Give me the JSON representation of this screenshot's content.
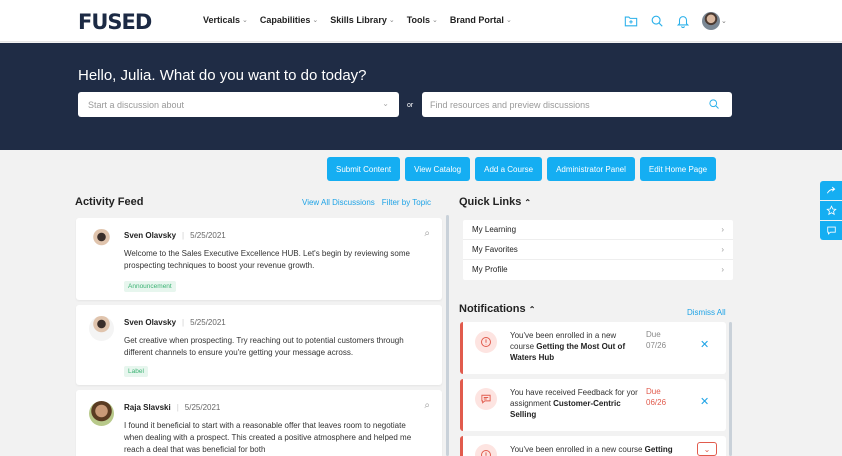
{
  "brand": {
    "logo_text": "FUSED",
    "accent": "#15aef2",
    "navy": "#1f2c45",
    "alert_red": "#e15b4d"
  },
  "nav": {
    "items": [
      {
        "label": "Verticals"
      },
      {
        "label": "Capabilities"
      },
      {
        "label": "Skills Library"
      },
      {
        "label": "Tools"
      },
      {
        "label": "Brand Portal"
      }
    ],
    "icons": [
      "add-folder-icon",
      "search-icon",
      "bell-icon",
      "user-avatar"
    ]
  },
  "hero": {
    "greeting": "Hello, Julia. What do you want to do today?",
    "discussion_placeholder": "Start a discussion about",
    "or_label": "or",
    "search_placeholder": "Find resources and preview discussions"
  },
  "actions": [
    {
      "label": "Submit Content"
    },
    {
      "label": "View Catalog"
    },
    {
      "label": "Add a Course"
    },
    {
      "label": "Administrator Panel"
    },
    {
      "label": "Edit Home Page"
    }
  ],
  "feed": {
    "title": "Activity Feed",
    "view_all": "View All Discussions",
    "filter": "Filter by Topic",
    "posts": [
      {
        "author": "Sven Olavsky",
        "date": "5/25/2021",
        "body": "Welcome to the Sales Executive Excellence HUB. Let's begin by reviewing some prospecting techniques to boost your revenue growth.",
        "tag": "Announcement"
      },
      {
        "author": "Sven Olavsky",
        "date": "5/25/2021",
        "body": "Get creative when prospecting. Try reaching out to potential customers through different channels to ensure you're getting your message across.",
        "tag": "Label"
      },
      {
        "author": "Raja Slavski",
        "date": "5/25/2021",
        "body": "I found it beneficial to start with a reasonable offer that leaves room to negotiate when dealing with a prospect. This created a positive atmosphere and helped me reach a deal that was beneficial for both"
      }
    ]
  },
  "quick_links": {
    "title": "Quick Links",
    "items": [
      {
        "label": "My Learning"
      },
      {
        "label": "My Favorites"
      },
      {
        "label": "My Profile"
      }
    ]
  },
  "notifications": {
    "title": "Notifications",
    "dismiss_all": "Dismiss All",
    "items": [
      {
        "text": "You've been enrolled in a new course ",
        "bold": "Getting the Most Out of Waters Hub",
        "due_label": "Due",
        "due_date": "07/26"
      },
      {
        "text": "You have received Feedback for yor assignment ",
        "bold": "Customer-Centric Selling",
        "due_label": "Due",
        "due_date": "06/26"
      },
      {
        "text": "You've been enrolled in a new course ",
        "bold": "Getting"
      }
    ]
  },
  "side_buttons": [
    "share-icon",
    "star-icon",
    "chat-icon"
  ]
}
